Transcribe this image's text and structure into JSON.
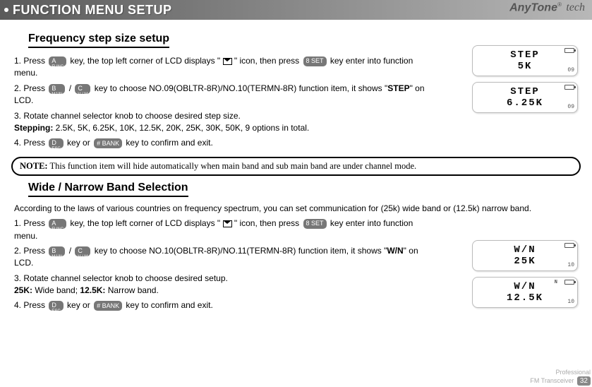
{
  "header": {
    "title": "FUNCTION MENU SETUP"
  },
  "brand": {
    "name": "AnyTone",
    "suffix": "tech"
  },
  "sec1": {
    "title": "Frequency step size setup",
    "s1a": "1. Press ",
    "s1b": " key, the top left corner of LCD displays \" ",
    "s1c": "\" icon, then press ",
    "s1d": " key enter into function menu.",
    "s2a": "2. Press ",
    "s2b": " / ",
    "s2c": " key to choose NO.09(OBLTR-8R)/NO.10(TERMN-8R) function item, it shows \"",
    "s2d": "STEP",
    "s2e": "\" on LCD.",
    "s3a": "3. Rotate channel selector knob to choose desired step size.",
    "s3b": "Stepping:",
    "s3c": "  2.5K, 5K, 6.25K, 10K, 12.5K, 20K, 25K, 30K, 50K, 9 options in total.",
    "s4a": "4. Press ",
    "s4b": " key or ",
    "s4c": " key to confirm and exit."
  },
  "note": {
    "label": "NOTE:",
    "text": " This function item will hide automatically when main band and sub main band are under channel mode."
  },
  "sec2": {
    "title": "Wide / Narrow Band Selection",
    "intro": "According to the laws of various countries on frequency spectrum, you can set communication for (25k) wide band or (12.5k) narrow band.",
    "s1a": "1. Press ",
    "s1b": " key, the top left corner of LCD displays \" ",
    "s1c": " \" icon, then press ",
    "s1d": " key enter into function menu.",
    "s2a": "2. Press ",
    "s2b": " / ",
    "s2c": " key to choose NO.10(OBLTR-8R)/NO.11(TERMN-8R) function item, it shows \"",
    "s2d": "W/N",
    "s2e": "\" on LCD.",
    "s3a": "3. Rotate channel selector knob to choose desired setup.",
    "s3b": "25K:",
    "s3c": " Wide band;   ",
    "s3d": "12.5K:",
    "s3e": " Narrow band.",
    "s4a": "4. Press ",
    "s4b": " key or ",
    "s4c": " key to confirm and exit."
  },
  "keys": {
    "a": "A",
    "a_sub": "FUNC",
    "b": "B",
    "b_sub": "MAIN",
    "c": "C",
    "c_sub": "V / M",
    "d": "D",
    "d_sub": "ESC",
    "eight": "8 SET",
    "hash": "# BANK"
  },
  "lcd": {
    "step1_l1": "STEP",
    "step1_l2": "5K",
    "step1_ch": "09",
    "step2_l1": "STEP",
    "step2_l2": "6.25K",
    "step2_ch": "09",
    "wn1_l1": "W/N",
    "wn1_l2": "25K",
    "wn1_ch": "10",
    "wn2_l1": "W/N",
    "wn2_l2": "12.5K",
    "wn2_ch": "10",
    "n": "N"
  },
  "footer": {
    "l1": "Professional",
    "l2": "FM Transceiver",
    "page": "32"
  }
}
